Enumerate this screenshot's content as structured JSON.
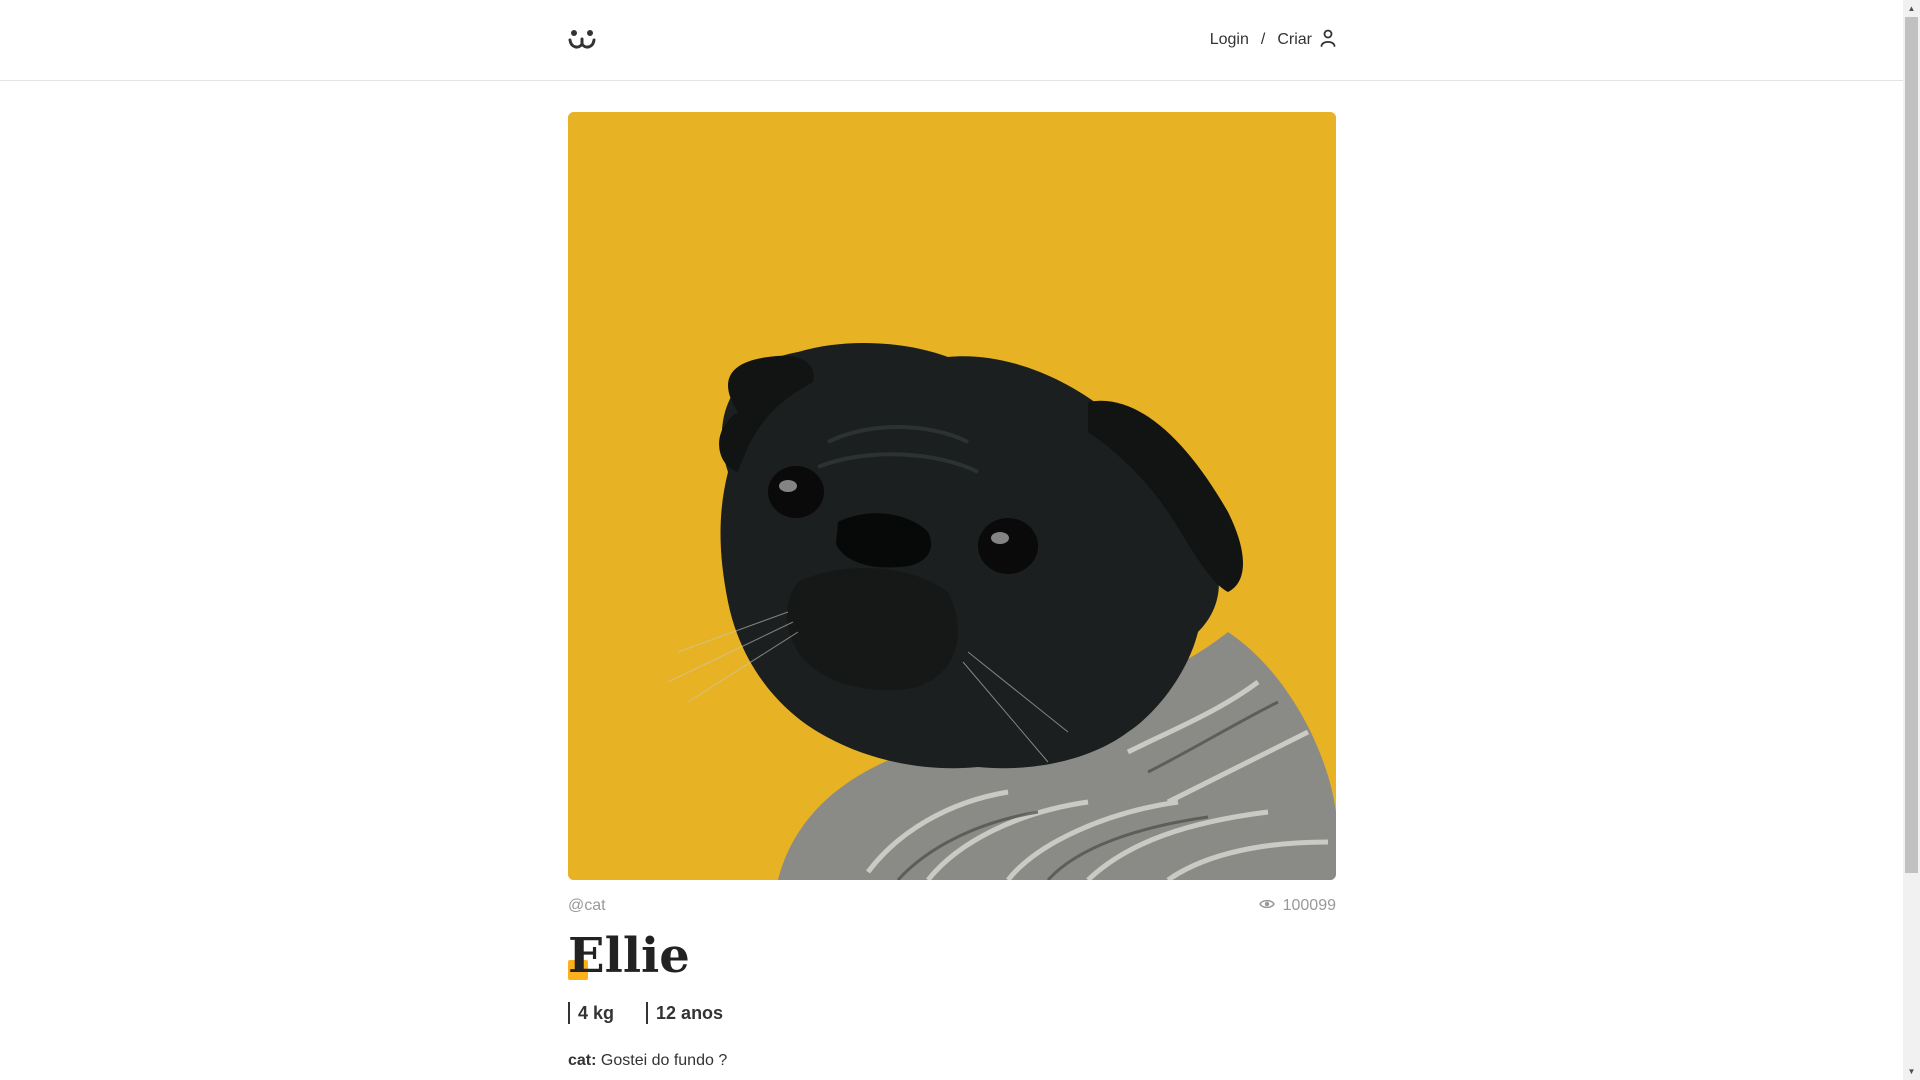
{
  "header": {
    "login_label": "Login",
    "separator": "/",
    "create_label": "Criar"
  },
  "photo": {
    "background_color": "#e8b225",
    "subject": "black pug wearing knitted sweater"
  },
  "post": {
    "author": "@cat",
    "views": "100099",
    "title": "Ellie",
    "weight": "4 kg",
    "age": "12 anos"
  },
  "comments": [
    {
      "author": "cat:",
      "text": "Gostei do fundo ?"
    }
  ],
  "colors": {
    "accent": "#fbb11b",
    "text": "#333333",
    "muted": "#999999"
  }
}
